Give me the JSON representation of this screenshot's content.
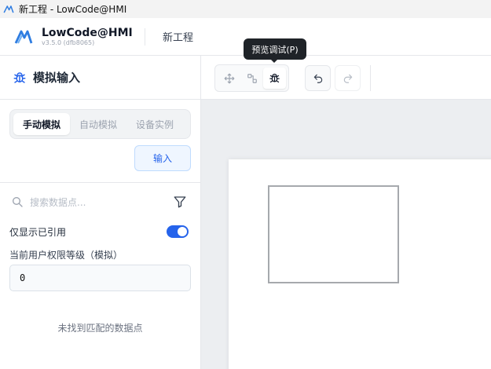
{
  "window": {
    "title": "新工程 - LowCode@HMI"
  },
  "app": {
    "name": "LowCode@HMI",
    "version": "v3.5.0 (dfb8065)",
    "project_name": "新工程"
  },
  "sim_panel": {
    "title": "模拟输入",
    "tabs": [
      {
        "label": "手动模拟",
        "active": true
      },
      {
        "label": "自动模拟",
        "active": false
      },
      {
        "label": "设备实例",
        "active": false
      }
    ],
    "input_button": "输入",
    "search_placeholder": "搜索数据点...",
    "only_referenced_label": "仅显示已引用",
    "only_referenced_on": true,
    "permission_label": "当前用户权限等级（模拟）",
    "permission_value": "0",
    "empty_message": "未找到匹配的数据点"
  },
  "toolbar": {
    "tooltip": "预览调试(P)"
  },
  "colors": {
    "accent": "#2563eb",
    "tooltip_bg": "#1f2328",
    "canvas_bg": "#eceef1"
  }
}
